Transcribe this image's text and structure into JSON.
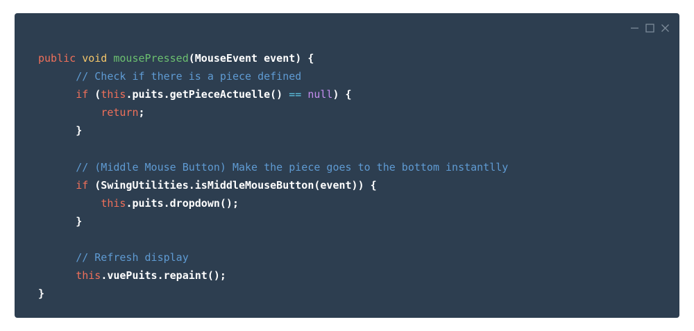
{
  "window": {
    "controls": [
      "minimize-icon",
      "maximize-icon",
      "close-icon"
    ],
    "background": "#2d3e50"
  },
  "code": {
    "language": "java",
    "lines": [
      [
        {
          "t": "keyword",
          "v": "public "
        },
        {
          "t": "type",
          "v": "void "
        },
        {
          "t": "func",
          "v": "mousePressed"
        },
        {
          "t": "plain",
          "v": "(MouseEvent event) {"
        }
      ],
      [
        {
          "t": "indent",
          "v": "      "
        },
        {
          "t": "comment",
          "v": "// Check if there is a piece defined"
        }
      ],
      [
        {
          "t": "indent",
          "v": "      "
        },
        {
          "t": "keyword",
          "v": "if "
        },
        {
          "t": "plain",
          "v": "("
        },
        {
          "t": "this",
          "v": "this"
        },
        {
          "t": "plain",
          "v": ".puits.getPieceActuelle() "
        },
        {
          "t": "op",
          "v": "=="
        },
        {
          "t": "plain",
          "v": " "
        },
        {
          "t": "null",
          "v": "null"
        },
        {
          "t": "plain",
          "v": ") {"
        }
      ],
      [
        {
          "t": "indent",
          "v": "          "
        },
        {
          "t": "keyword",
          "v": "return"
        },
        {
          "t": "plain",
          "v": ";"
        }
      ],
      [
        {
          "t": "indent",
          "v": "      "
        },
        {
          "t": "plain",
          "v": "}"
        }
      ],
      [],
      [
        {
          "t": "indent",
          "v": "      "
        },
        {
          "t": "comment",
          "v": "// (Middle Mouse Button) Make the piece goes to the bottom instantlly"
        }
      ],
      [
        {
          "t": "indent",
          "v": "      "
        },
        {
          "t": "keyword",
          "v": "if "
        },
        {
          "t": "plain",
          "v": "(SwingUtilities.isMiddleMouseButton(event)) {"
        }
      ],
      [
        {
          "t": "indent",
          "v": "          "
        },
        {
          "t": "this",
          "v": "this"
        },
        {
          "t": "plain",
          "v": ".puits.dropdown();"
        }
      ],
      [
        {
          "t": "indent",
          "v": "      "
        },
        {
          "t": "plain",
          "v": "}"
        }
      ],
      [],
      [
        {
          "t": "indent",
          "v": "      "
        },
        {
          "t": "comment",
          "v": "// Refresh display"
        }
      ],
      [
        {
          "t": "indent",
          "v": "      "
        },
        {
          "t": "this",
          "v": "this"
        },
        {
          "t": "plain",
          "v": ".vuePuits.repaint();"
        }
      ],
      [
        {
          "t": "plain",
          "v": "}"
        }
      ]
    ]
  }
}
